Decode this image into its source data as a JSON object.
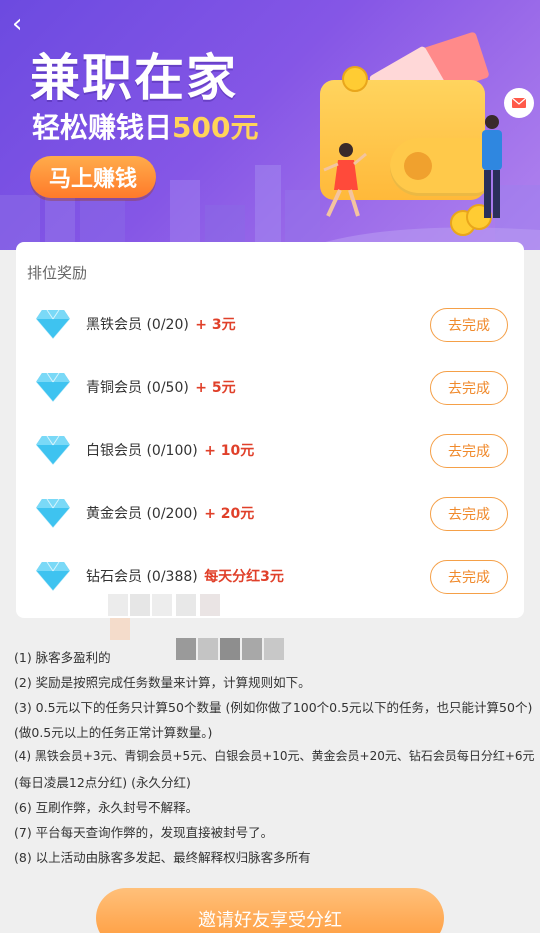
{
  "banner": {
    "back_icon": "chevron-left-icon",
    "title": "兼职在家",
    "sub_prefix": "轻松赚钱日",
    "sub_amount": "500元",
    "cta": "马上赚钱"
  },
  "card": {
    "title": "排位奖励",
    "rows": [
      {
        "name": "黑铁会员 (0/20)",
        "reward": "+ 3元",
        "button": "去完成"
      },
      {
        "name": "青铜会员 (0/50)",
        "reward": "+ 5元",
        "button": "去完成"
      },
      {
        "name": "白银会员 (0/100)",
        "reward": "+ 10元",
        "button": "去完成"
      },
      {
        "name": "黄金会员 (0/200)",
        "reward": "+ 20元",
        "button": "去完成"
      },
      {
        "name": "钻石会员 (0/388)",
        "reward": "每天分红3元",
        "button": "去完成"
      }
    ]
  },
  "rules": [
    "(1) 脉客多盈利的",
    "(2) 奖励是按照完成任务数量来计算，计算规则如下。",
    "(3) 0.5元以下的任务只计算50个数量 (例如你做了100个0.5元以下的任务，也只能计算50个)",
    "(做0.5元以上的任务正常计算数量。)",
    "(4) 黑铁会员+3元、青铜会员+5元、白银会员+10元、黄金会员+20元、钻石会员每日分红+6元",
    "(每日凌晨12点分红) (永久分红)",
    "(6) 互刷作弊，永久封号不解释。",
    "(7) 平台每天查询作弊的，发现直接被封号了。",
    "(8) 以上活动由脉客多发起、最终解释权归脉客多所有"
  ],
  "invite_button": "邀请好友享受分红",
  "colors": {
    "banner_start": "#6c4ae0",
    "banner_end": "#b184ef",
    "accent_orange": "#f08a2c",
    "reward_red": "#e0402a",
    "diamond_blue": "#3ec3f0"
  }
}
